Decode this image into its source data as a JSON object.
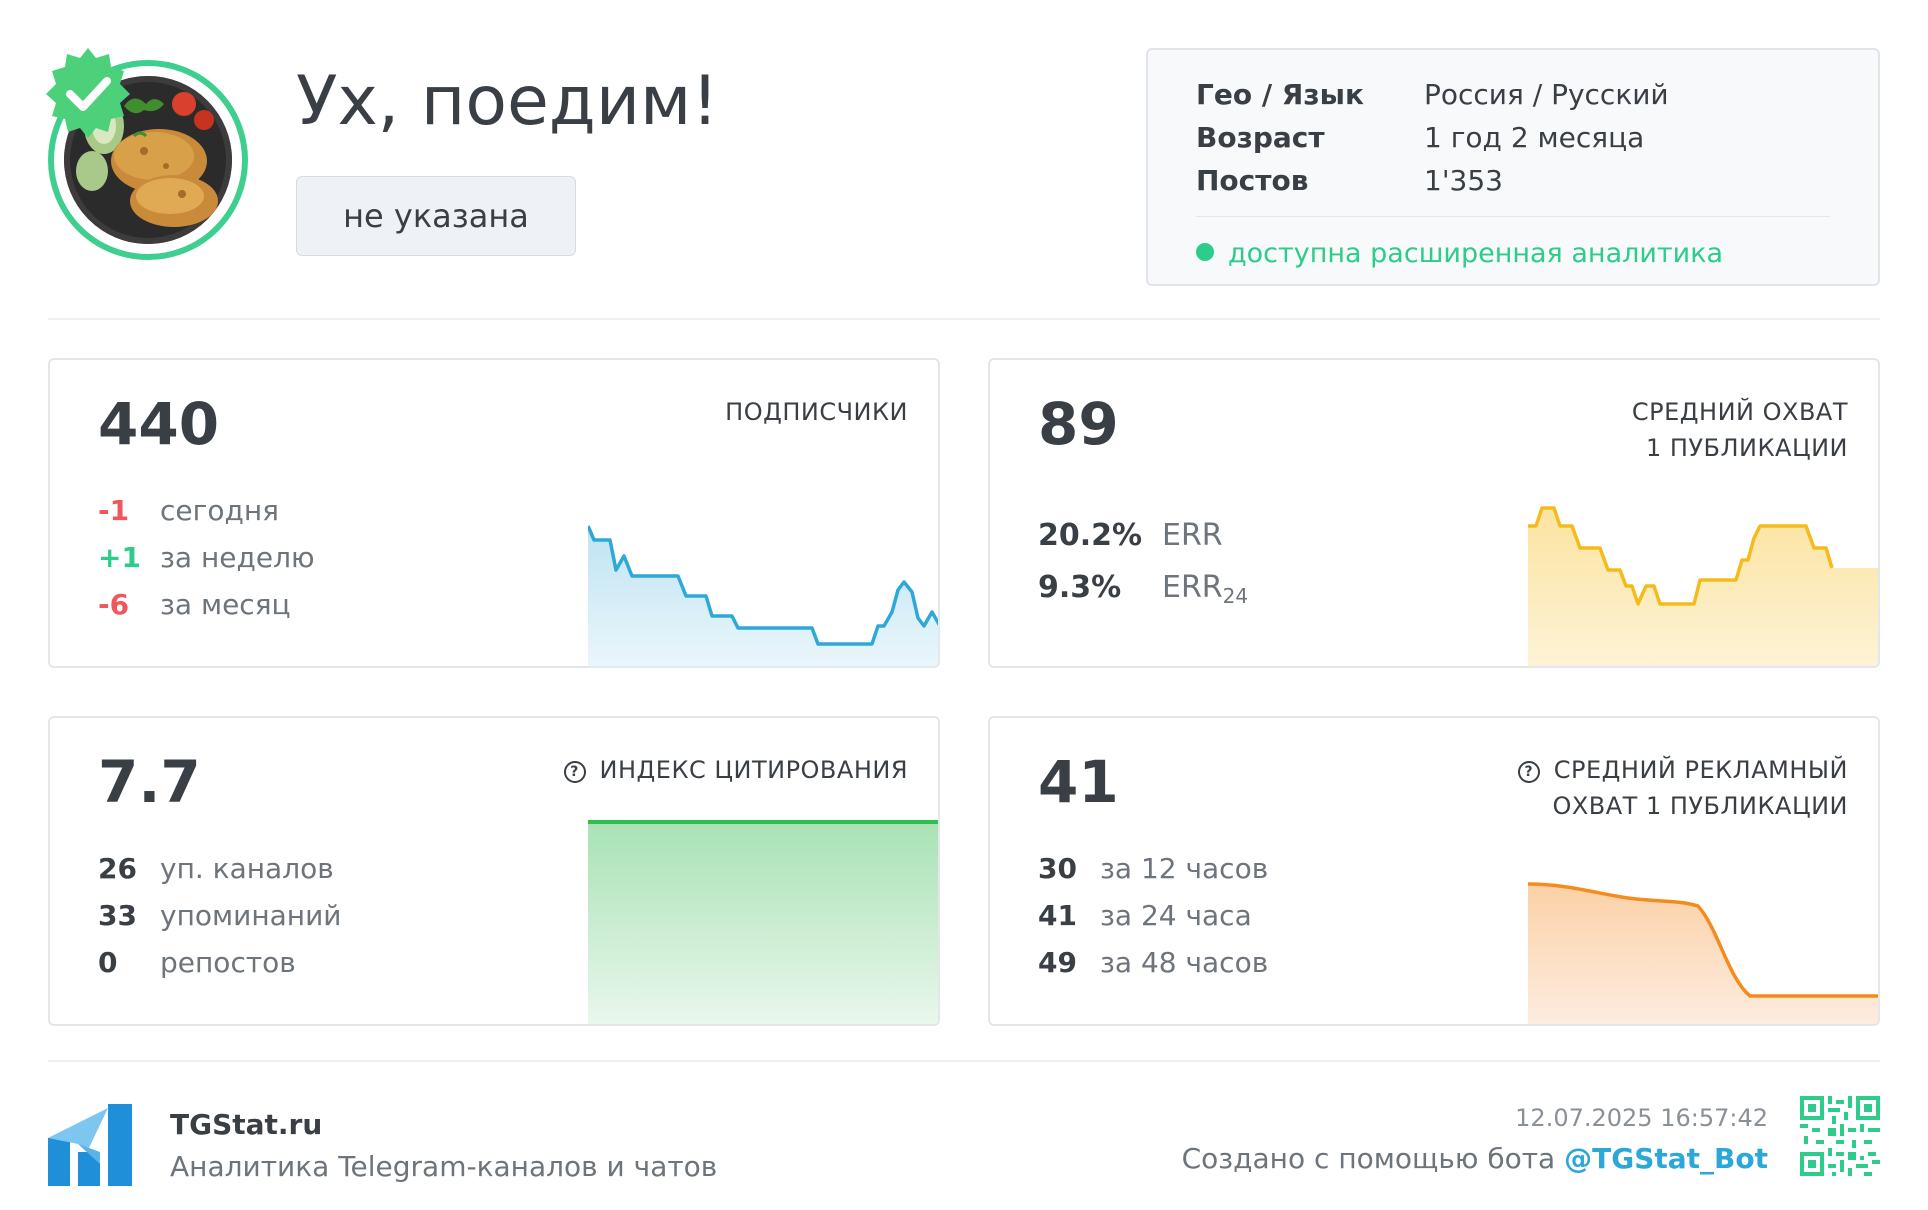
{
  "header": {
    "title": "Ух, поедим!",
    "category_button": "не указана",
    "verified_icon": "verified-badge-icon",
    "avatar_icon": "channel-avatar-food"
  },
  "info": {
    "rows": [
      {
        "key": "Гео / Язык",
        "value": "Россия / Русский"
      },
      {
        "key": "Возраст",
        "value": "1 год 2 месяца"
      },
      {
        "key": "Постов",
        "value": "1'353"
      }
    ],
    "analytics_note": "доступна расширенная аналитика"
  },
  "cards": {
    "subscribers": {
      "value": "440",
      "label": "ПОДПИСЧИКИ",
      "rows": [
        {
          "n": "-1",
          "t": "сегодня"
        },
        {
          "n": "+1",
          "t": "за неделю"
        },
        {
          "n": "-6",
          "t": "за месяц"
        }
      ],
      "color": "#2ea8d6"
    },
    "reach": {
      "value": "89",
      "label_lines": [
        "СРЕДНИЙ ОХВАТ",
        "1 ПУБЛИКАЦИИ"
      ],
      "err": {
        "n": "20.2%",
        "t": "ERR"
      },
      "err24": {
        "n": "9.3%",
        "t": "ERR",
        "sub": "24"
      },
      "color": "#f5bb1c"
    },
    "citation": {
      "value": "7.7",
      "label": "ИНДЕКС ЦИТИРОВАНИЯ",
      "rows": [
        {
          "n": "26",
          "t": "уп. каналов"
        },
        {
          "n": "33",
          "t": "упоминаний"
        },
        {
          "n": "0",
          "t": "репостов"
        }
      ],
      "color": "#2fbf4e"
    },
    "ad_reach": {
      "value": "41",
      "label_lines": [
        "СРЕДНИЙ РЕКЛАМНЫЙ",
        "ОХВАТ 1 ПУБЛИКАЦИИ"
      ],
      "rows": [
        {
          "n": "30",
          "t": "за 12 часов"
        },
        {
          "n": "41",
          "t": "за 24 часа"
        },
        {
          "n": "49",
          "t": "за 48 часов"
        }
      ],
      "color": "#f58b1c"
    }
  },
  "footer": {
    "brand": "TGStat.ru",
    "tagline": "Аналитика Telegram-каналов и чатов",
    "timestamp": "12.07.2025 16:57:42",
    "created_with": "Создано с помощью бота",
    "bot": "@TGStat_Bot",
    "logo_icon": "tgstat-logo-icon",
    "qr_icon": "qr-code-icon"
  }
}
